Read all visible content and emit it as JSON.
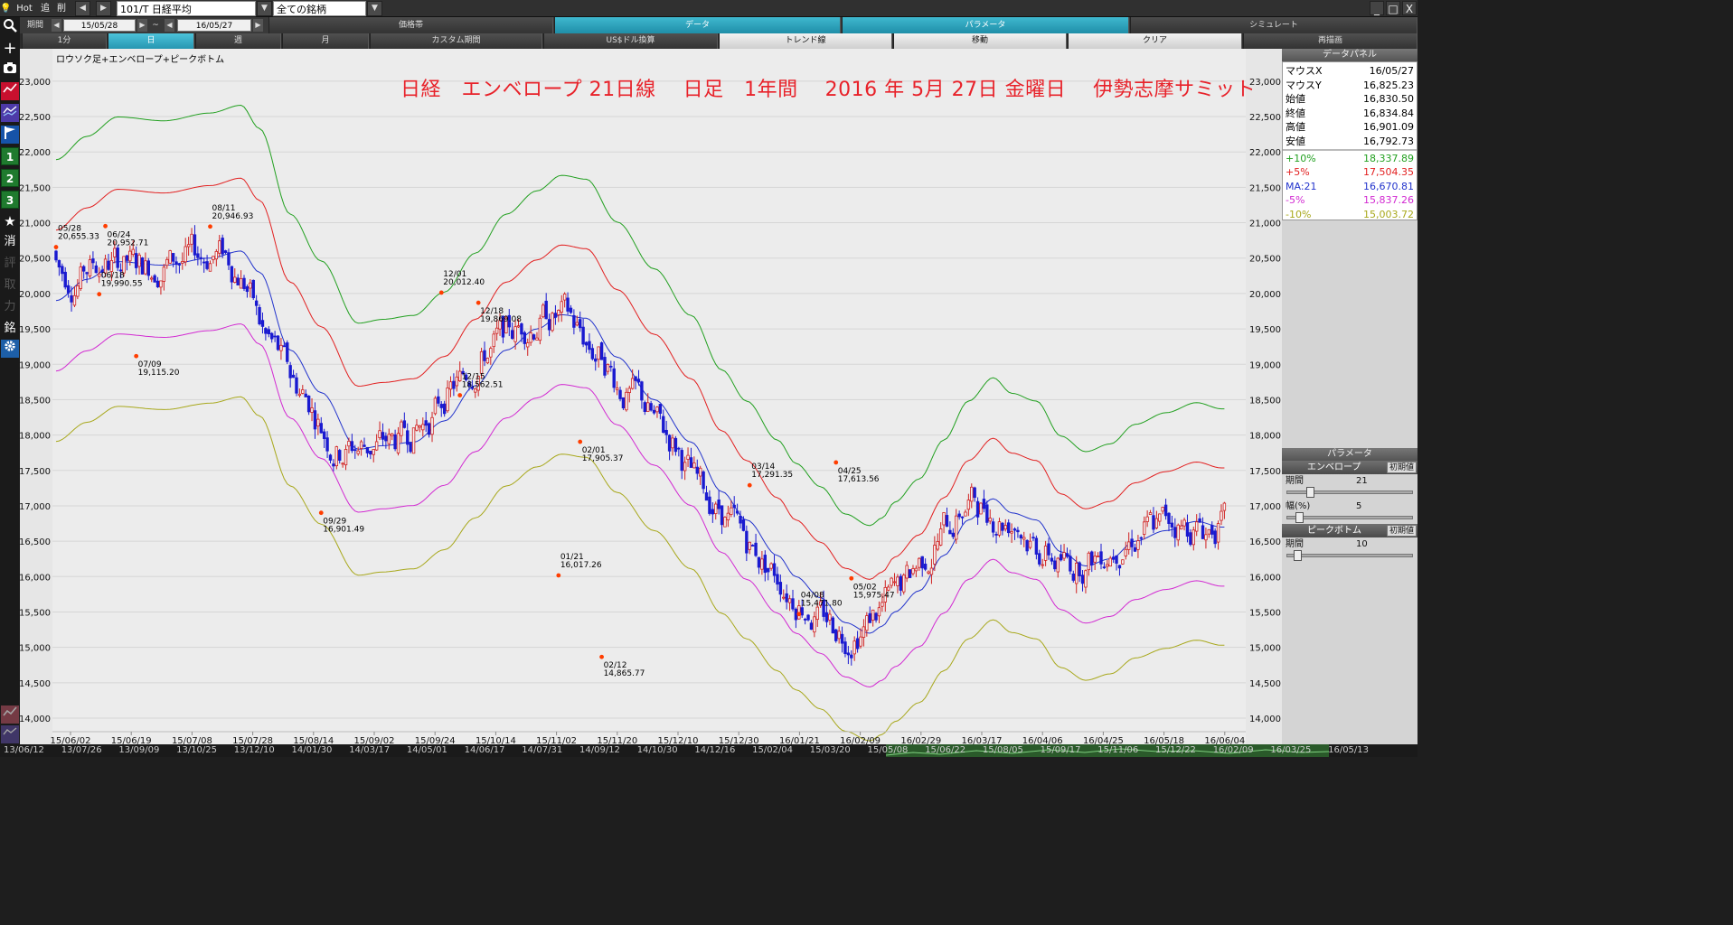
{
  "topbar": {
    "hot_label": "Hot",
    "add_label": "追",
    "del_label": "削",
    "symbol": "101/T 日経平均",
    "universe": "全ての銘柄",
    "min_label": "_",
    "max_label": "□",
    "close_label": "X"
  },
  "row2": {
    "period_label": "期間",
    "from_date": "15/05/28",
    "tilde": "~",
    "to_date": "16/05/27",
    "tabs": [
      {
        "label": "価格帯",
        "active": false
      },
      {
        "label": "データ",
        "active": true
      },
      {
        "label": "パラメータ",
        "active": true
      },
      {
        "label": "シミュレート",
        "active": false
      }
    ]
  },
  "row3": {
    "tabs": [
      {
        "label": "1分",
        "state": "dark"
      },
      {
        "label": "日",
        "state": "on"
      },
      {
        "label": "週",
        "state": "dark"
      },
      {
        "label": "月",
        "state": "dark"
      },
      {
        "label": "カスタム期間",
        "state": "dark"
      },
      {
        "label": "US$ドル換算",
        "state": "dark"
      },
      {
        "label": "トレンド線",
        "state": "light"
      },
      {
        "label": "移動",
        "state": "light"
      },
      {
        "label": "クリア",
        "state": "light"
      },
      {
        "label": "再描画",
        "state": "dark"
      }
    ]
  },
  "left_toolbar": {
    "numbers": [
      "1",
      "2",
      "3"
    ],
    "kanji": [
      "消",
      "評",
      "取",
      "力",
      "銘"
    ]
  },
  "chart": {
    "subtitle": "ロウソク足+エンベロープ+ピークボトム",
    "title": "日経　エンベロープ 21日線　 日足　1年間　 2016 年 5月 27日 金曜日　 伊勢志摩サミット",
    "annotations": [
      {
        "date": "05/28",
        "price": "20,655.33"
      },
      {
        "date": "06/24",
        "price": "20,952.71"
      },
      {
        "date": "06/18",
        "price": "19,990.55"
      },
      {
        "date": "07/09",
        "price": "19,115.20"
      },
      {
        "date": "08/11",
        "price": "20,946.93"
      },
      {
        "date": "09/29",
        "price": "16,901.49"
      },
      {
        "date": "12/01",
        "price": "20,012.40"
      },
      {
        "date": "12/18",
        "price": "19,869.08"
      },
      {
        "date": "12/15",
        "price": "18,562.51"
      },
      {
        "date": "02/01",
        "price": "17,905.37"
      },
      {
        "date": "01/21",
        "price": "16,017.26"
      },
      {
        "date": "02/12",
        "price": "14,865.77"
      },
      {
        "date": "03/14",
        "price": "17,291.35"
      },
      {
        "date": "04/25",
        "price": "17,613.56"
      },
      {
        "date": "04/08",
        "price": "15,471.80"
      },
      {
        "date": "05/02",
        "price": "15,975.47"
      }
    ]
  },
  "chart_data": {
    "type": "candlestick",
    "ylim": [
      13900,
      23250
    ],
    "yticks": [
      23000,
      22500,
      22000,
      21500,
      21000,
      20500,
      20000,
      19500,
      19000,
      18500,
      18000,
      17500,
      17000,
      16500,
      16000,
      15500,
      15000,
      14500,
      14000
    ],
    "ytick_labels": [
      "23,000",
      "22,500",
      "22,000",
      "21,500",
      "21,000",
      "20,500",
      "20,000",
      "19,500",
      "19,000",
      "18,500",
      "18,000",
      "17,500",
      "17,000",
      "16,500",
      "16,000",
      "15,500",
      "15,000",
      "14,500",
      "14,000"
    ],
    "xtick_labels": [
      "15/06/02",
      "15/06/19",
      "15/07/08",
      "15/07/28",
      "15/08/14",
      "15/09/02",
      "15/09/24",
      "15/10/14",
      "15/11/02",
      "15/11/20",
      "15/12/10",
      "15/12/30",
      "16/01/21",
      "16/02/09",
      "16/02/29",
      "16/03/17",
      "16/04/06",
      "16/04/25",
      "16/05/18",
      "16/06/04"
    ],
    "ma_anchors": [
      [
        0,
        19900
      ],
      [
        10,
        20200
      ],
      [
        20,
        20450
      ],
      [
        35,
        20400
      ],
      [
        50,
        20500
      ],
      [
        60,
        20600
      ],
      [
        66,
        20300
      ],
      [
        76,
        19200
      ],
      [
        86,
        18600
      ],
      [
        98,
        17800
      ],
      [
        106,
        17850
      ],
      [
        116,
        17900
      ],
      [
        126,
        18200
      ],
      [
        136,
        18700
      ],
      [
        146,
        19200
      ],
      [
        156,
        19500
      ],
      [
        164,
        19700
      ],
      [
        172,
        19650
      ],
      [
        182,
        19100
      ],
      [
        194,
        18500
      ],
      [
        206,
        17900
      ],
      [
        216,
        17200
      ],
      [
        224,
        16800
      ],
      [
        234,
        16300
      ],
      [
        240,
        16000
      ],
      [
        248,
        15700
      ],
      [
        256,
        15350
      ],
      [
        264,
        15200
      ],
      [
        268,
        15300
      ],
      [
        272,
        15500
      ],
      [
        280,
        15800
      ],
      [
        288,
        16300
      ],
      [
        296,
        16800
      ],
      [
        304,
        17100
      ],
      [
        310,
        16900
      ],
      [
        318,
        16800
      ],
      [
        326,
        16350
      ],
      [
        334,
        16150
      ],
      [
        342,
        16250
      ],
      [
        350,
        16500
      ],
      [
        360,
        16650
      ],
      [
        370,
        16780
      ],
      [
        378,
        16700
      ]
    ],
    "band_pct": [
      10,
      5,
      -5,
      -10
    ],
    "series": [
      {
        "name": "+10%",
        "color": "#22a020"
      },
      {
        "name": "+5%",
        "color": "#e22020"
      },
      {
        "name": "MA:21",
        "color": "#2233cc"
      },
      {
        "name": "-5%",
        "color": "#d22ad2"
      },
      {
        "name": "-10%",
        "color": "#a8a81c"
      }
    ],
    "candles_note": "daily OHLC following MA path",
    "markers": [
      {
        "i": 0,
        "price": 20655
      },
      {
        "i": 16,
        "price": 20952
      },
      {
        "i": 14,
        "price": 19990
      },
      {
        "i": 26,
        "price": 19115
      },
      {
        "i": 50,
        "price": 20946
      },
      {
        "i": 86,
        "price": 16901
      },
      {
        "i": 125,
        "price": 20012
      },
      {
        "i": 137,
        "price": 19869
      },
      {
        "i": 131,
        "price": 18562
      },
      {
        "i": 170,
        "price": 17905
      },
      {
        "i": 163,
        "price": 16017
      },
      {
        "i": 177,
        "price": 14865
      },
      {
        "i": 225,
        "price": 17291
      },
      {
        "i": 253,
        "price": 17613
      },
      {
        "i": 241,
        "price": 15471
      },
      {
        "i": 258,
        "price": 15975
      }
    ]
  },
  "bottom_bar": {
    "labels": [
      "13/06/12",
      "13/07/26",
      "13/09/09",
      "13/10/25",
      "13/12/10",
      "14/01/30",
      "14/03/17",
      "14/05/01",
      "14/06/17",
      "14/07/31",
      "14/09/12",
      "14/10/30",
      "14/12/16",
      "15/02/04",
      "15/03/20",
      "15/05/08",
      "15/06/22",
      "15/08/05",
      "15/09/17",
      "15/11/06",
      "15/12/22",
      "16/02/09",
      "16/03/25",
      "16/05/13"
    ]
  },
  "right_panel": {
    "data_header": "データパネル",
    "rows": [
      {
        "label": "マウスX",
        "value": "16/05/27",
        "color": "#000000"
      },
      {
        "label": "マウスY",
        "value": "16,825.23",
        "color": "#000000"
      },
      {
        "label": "始値",
        "value": "16,830.50",
        "color": "#000000"
      },
      {
        "label": "終値",
        "value": "16,834.84",
        "color": "#000000"
      },
      {
        "label": "高値",
        "value": "16,901.09",
        "color": "#000000"
      },
      {
        "label": "安値",
        "value": "16,792.73",
        "color": "#000000"
      },
      {
        "label": "+10%",
        "value": "18,337.89",
        "color": "#22a020"
      },
      {
        "label": "+5%",
        "value": "17,504.35",
        "color": "#e22020"
      },
      {
        "label": "MA:21",
        "value": "16,670.81",
        "color": "#2233cc"
      },
      {
        "label": "-5%",
        "value": "15,837.26",
        "color": "#d22ad2"
      },
      {
        "label": "-10%",
        "value": "15,003.72",
        "color": "#a8a81c"
      }
    ],
    "param_header": "パラメータ",
    "envelope_label": "エンベロープ",
    "reset_label": "初期値",
    "period_label": "期間",
    "period_value": "21",
    "width_label": "幅(%)",
    "width_value": "5",
    "peak_label": "ピークボトム",
    "peak_period_label": "期間",
    "peak_period_value": "10"
  }
}
